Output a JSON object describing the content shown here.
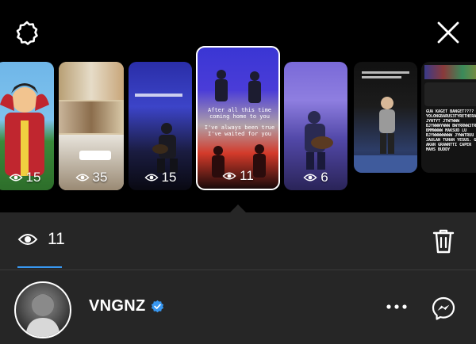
{
  "colors": {
    "background": "#000000",
    "panel": "#262626",
    "accent": "#3897f0"
  },
  "topbar": {
    "settings_icon": "gear-icon",
    "close_icon": "close-icon"
  },
  "thumbnails": [
    {
      "count": "15",
      "theme": "cartoon"
    },
    {
      "count": "35",
      "theme": "collage"
    },
    {
      "count": "15",
      "theme": "concert-blue",
      "caption": ""
    },
    {
      "count": "11",
      "theme": "concert-active",
      "active": true,
      "caption_1": "After all this time",
      "caption_2": "coming home to you",
      "caption_3": "I've always been true",
      "caption_4": "I've waited for you"
    },
    {
      "count": "6",
      "theme": "concert-purple"
    },
    {
      "count": "",
      "theme": "stage"
    },
    {
      "count": "",
      "theme": "dark-text",
      "caption": "GUA KAGET BANGET???? YOLONGBARUS3TYRETHERAPY JYNTYT JTWTWWW BJYWWWYWWW BWYRRWW3TRRY BMMWWWW MAKSUD LU BJYWWWWWWWW JYWWTRUU JAULAN TUHAN YESUS. GUA AKAN GRAWNTTI CAPER MAHS BUDDY"
    }
  ],
  "stats": {
    "views": "11",
    "views_icon": "eye-icon",
    "trash_icon": "trash-icon"
  },
  "viewer": {
    "username": "VNGNZ",
    "verified_icon": "verified-badge-icon",
    "more_icon": "more-icon",
    "messenger_icon": "messenger-icon"
  }
}
